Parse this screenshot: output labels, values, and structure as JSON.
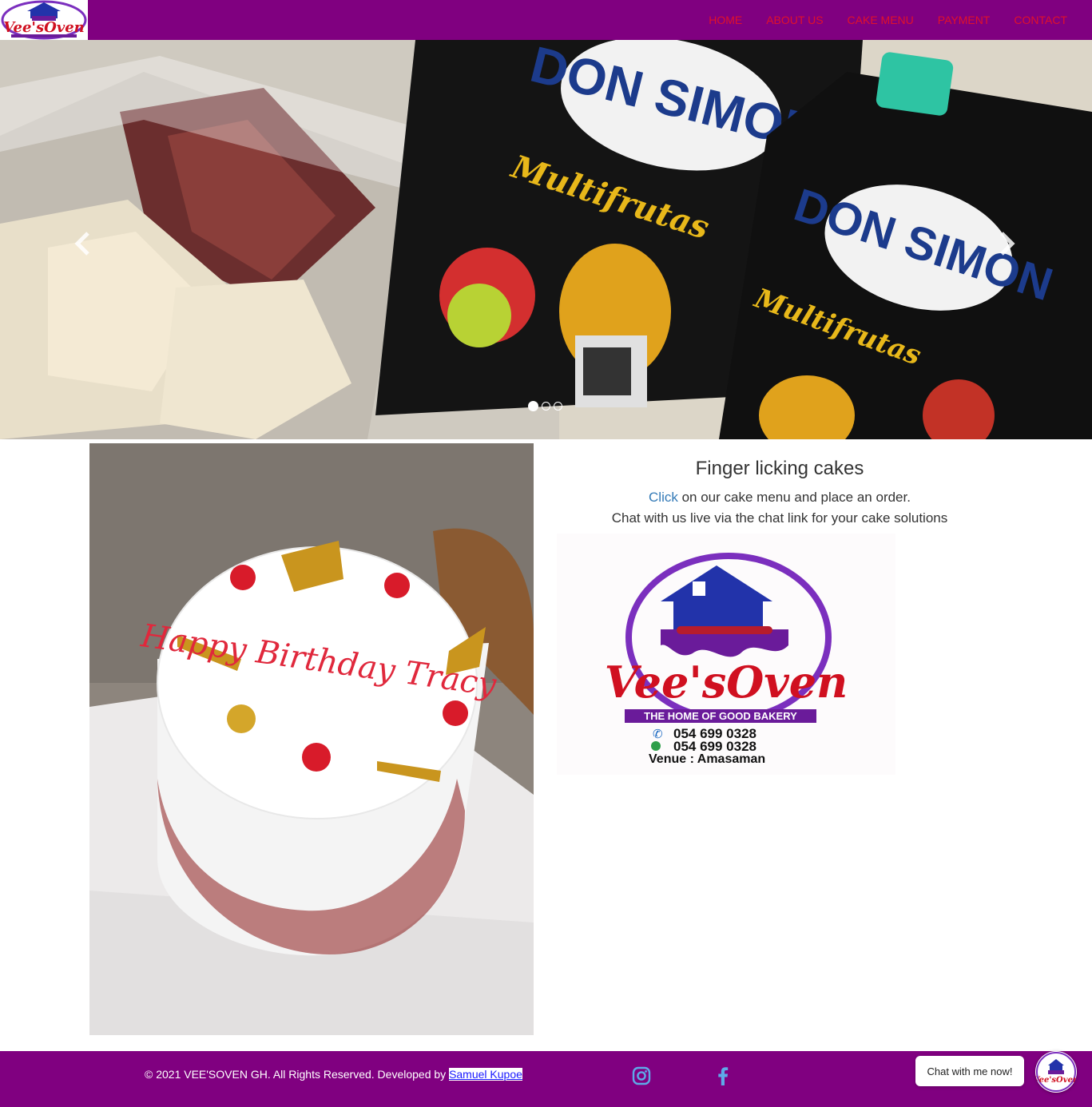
{
  "brand": {
    "logo_text": "Vee'sOven",
    "logo_tagline": "THE HOME OF GOOD BAKERY"
  },
  "nav": {
    "items": [
      {
        "label": "HOME"
      },
      {
        "label": "ABOUT US"
      },
      {
        "label": "CAKE MENU"
      },
      {
        "label": "PAYMENT"
      },
      {
        "label": "CONTACT"
      }
    ],
    "colors": {
      "bar": "#800080",
      "link": "#e0112b"
    }
  },
  "carousel": {
    "slide_count": 3,
    "active_index": 0,
    "prev_icon": "chevron-left-icon",
    "next_icon": "chevron-right-icon",
    "packaging_brand": "DON SIMON",
    "packaging_product": "Multifrutas"
  },
  "cake_photo": {
    "inscription": "Happy Birthday Tracy"
  },
  "promo": {
    "heading": "Finger licking cakes",
    "link_text": "Click",
    "line1_rest": " on our cake menu and place an order.",
    "line2": "Chat with us live via the chat link for your cake solutions"
  },
  "logo_card": {
    "name": "Vee'sOven",
    "tagline": "THE HOME OF GOOD BAKERY",
    "phone": "054 699 0328",
    "whatsapp": "054 699 0328",
    "venue": "Venue : Amasaman"
  },
  "footer": {
    "copyright": "© 2021 VEE'SOVEN GH. All Rights Reserved. Developed by ",
    "developer": "Samuel Kupoe",
    "social": [
      "instagram-icon",
      "facebook-icon"
    ],
    "colors": {
      "bar": "#800080",
      "icon": "#5ea9e8"
    }
  },
  "chat": {
    "label": "Chat with me now!"
  }
}
